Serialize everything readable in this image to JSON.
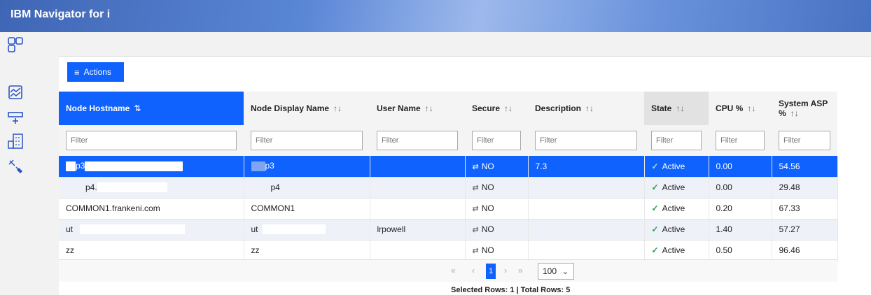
{
  "app": {
    "title": "IBM Navigator for i"
  },
  "nav_icons": [
    "dashboard-icon",
    "monitor-icon",
    "add-system-icon",
    "building-icon",
    "tools-icon"
  ],
  "toolbar": {
    "actions_label": "Actions",
    "actions_icon": "menu-icon"
  },
  "table": {
    "columns": [
      {
        "label": "Node Hostname",
        "sort": "⇅"
      },
      {
        "label": "Node Display Name",
        "sort": "↑↓"
      },
      {
        "label": "User Name",
        "sort": "↑↓"
      },
      {
        "label": "Secure",
        "sort": "↑↓"
      },
      {
        "label": "Description",
        "sort": "↑↓"
      },
      {
        "label": "State",
        "sort": "↑↓"
      },
      {
        "label": "CPU %",
        "sort": "↑↓"
      },
      {
        "label": "System ASP %",
        "sort": "↑↓"
      }
    ],
    "filter_placeholder": "Filter",
    "rows": [
      {
        "hostname": "p3",
        "display": "p3",
        "user": "",
        "secure": "NO",
        "description": "7.3",
        "state": "Active",
        "cpu": "0.00",
        "asp": "54.56",
        "selected": true
      },
      {
        "hostname": "p4.",
        "display": "p4",
        "user": "",
        "secure": "NO",
        "description": "",
        "state": "Active",
        "cpu": "0.00",
        "asp": "29.48",
        "selected": false
      },
      {
        "hostname": "COMMON1.frankeni.com",
        "display": "COMMON1",
        "user": "",
        "secure": "NO",
        "description": "",
        "state": "Active",
        "cpu": "0.20",
        "asp": "67.33",
        "selected": false
      },
      {
        "hostname": "ut",
        "display": "ut",
        "user": "lrpowell",
        "secure": "NO",
        "description": "",
        "state": "Active",
        "cpu": "1.40",
        "asp": "57.27",
        "selected": false
      },
      {
        "hostname": "zz",
        "display": "zz",
        "user": "",
        "secure": "NO",
        "description": "",
        "state": "Active",
        "cpu": "0.50",
        "asp": "96.46",
        "selected": false
      }
    ]
  },
  "pagination": {
    "first": "«",
    "prev": "‹",
    "current": "1",
    "next": "›",
    "last": "»",
    "page_size": "100"
  },
  "status": {
    "text": "Selected Rows: 1 | Total Rows: 5"
  },
  "colors": {
    "accent": "#0f62fe",
    "active_check": "#24a148"
  }
}
